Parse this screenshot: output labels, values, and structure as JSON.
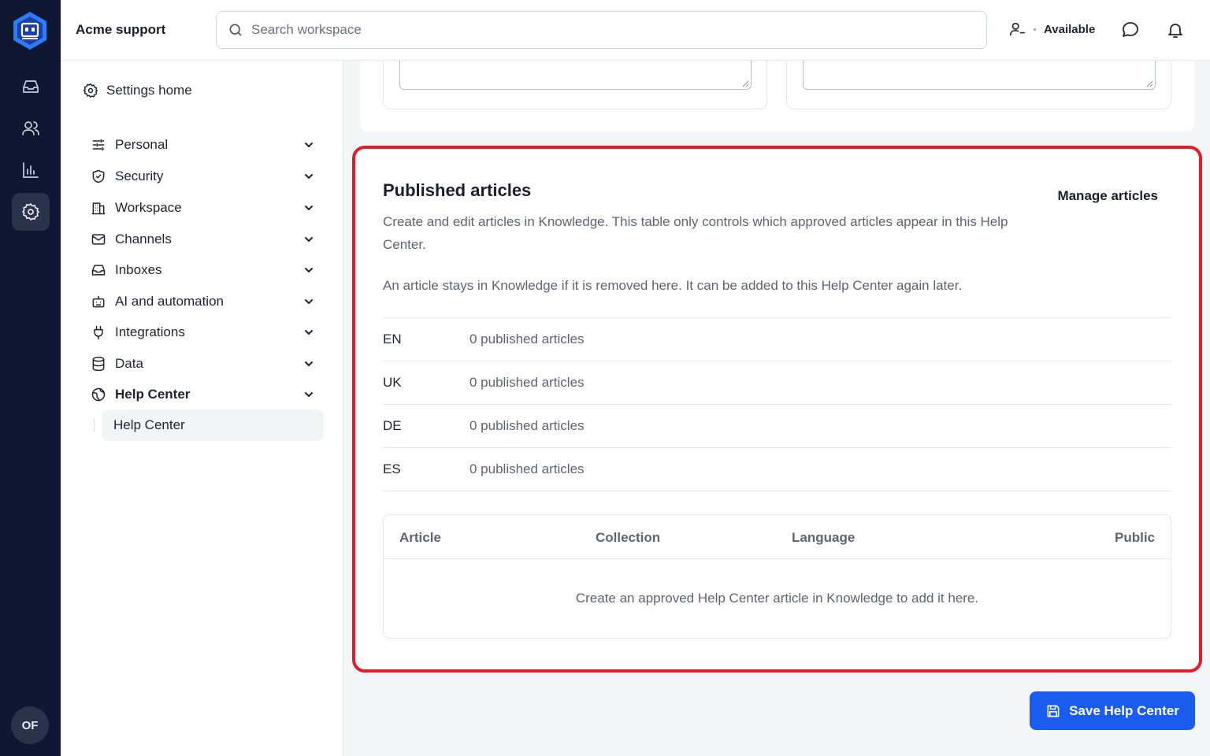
{
  "topbar": {
    "workspace_name": "Acme support",
    "search_placeholder": "Search workspace",
    "status_label": "Available"
  },
  "rail": {
    "avatar_initials": "OF"
  },
  "sidebar": {
    "home_label": "Settings home",
    "items": [
      {
        "label": "Personal"
      },
      {
        "label": "Security"
      },
      {
        "label": "Workspace"
      },
      {
        "label": "Channels"
      },
      {
        "label": "Inboxes"
      },
      {
        "label": "AI and automation"
      },
      {
        "label": "Integrations"
      },
      {
        "label": "Data"
      },
      {
        "label": "Help Center"
      }
    ],
    "sub_item": "Help Center"
  },
  "published": {
    "title": "Published articles",
    "manage_label": "Manage articles",
    "description": "Create and edit articles in Knowledge. This table only controls which approved articles appear in this Help Center.",
    "note": "An article stays in Knowledge if it is removed here. It can be added to this Help Center again later.",
    "languages": [
      {
        "code": "EN",
        "count": "0 published articles"
      },
      {
        "code": "UK",
        "count": "0 published articles"
      },
      {
        "code": "DE",
        "count": "0 published articles"
      },
      {
        "code": "ES",
        "count": "0 published articles"
      }
    ],
    "table": {
      "columns": [
        "Article",
        "Collection",
        "Language",
        "Public"
      ],
      "empty_message": "Create an approved Help Center article in Knowledge to add it here."
    }
  },
  "save_label": "Save Help Center",
  "colors": {
    "rail_bg": "#0f1733",
    "accent_blue": "#1a5cf0",
    "highlight_red": "#e11d2a"
  }
}
